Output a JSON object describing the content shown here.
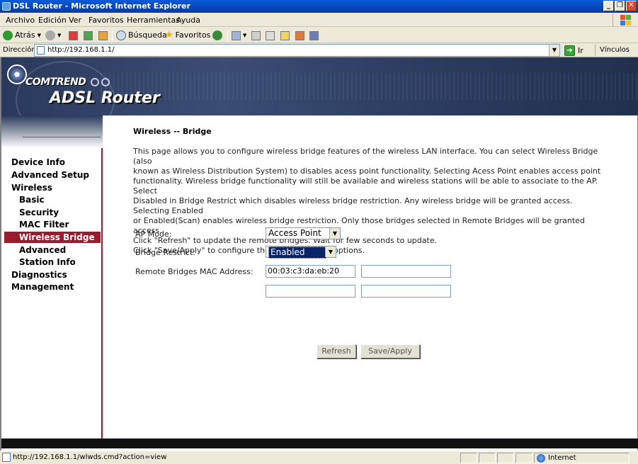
{
  "window": {
    "title": "DSL Router - Microsoft Internet Explorer",
    "controls": [
      "_",
      "❐",
      "✕"
    ]
  },
  "menu": [
    "Archivo",
    "Edición",
    "Ver",
    "Favoritos",
    "Herramientas",
    "Ayuda"
  ],
  "toolbar": {
    "back": "Atrás",
    "search": "Búsqueda",
    "favorites": "Favoritos"
  },
  "address": {
    "label": "Dirección",
    "url": "http://192.168.1.1/",
    "go": "Ir",
    "links": "Vínculos"
  },
  "banner": {
    "brand": "COMTREND",
    "product": "ADSL Router"
  },
  "sidebar": {
    "items": [
      {
        "label": "Device Info",
        "level": 0,
        "active": false
      },
      {
        "label": "Advanced Setup",
        "level": 0,
        "active": false
      },
      {
        "label": "Wireless",
        "level": 0,
        "active": false
      },
      {
        "label": "Basic",
        "level": 1,
        "active": false
      },
      {
        "label": "Security",
        "level": 1,
        "active": false
      },
      {
        "label": "MAC Filter",
        "level": 1,
        "active": false
      },
      {
        "label": "Wireless Bridge",
        "level": 1,
        "active": true
      },
      {
        "label": "Advanced",
        "level": 1,
        "active": false
      },
      {
        "label": "Station Info",
        "level": 1,
        "active": false
      },
      {
        "label": "Diagnostics",
        "level": 0,
        "active": false
      },
      {
        "label": "Management",
        "level": 0,
        "active": false
      }
    ]
  },
  "page": {
    "title": "Wireless -- Bridge",
    "description": [
      "This page allows you to configure wireless bridge features of the wireless LAN interface. You can select Wireless Bridge (also",
      "known as Wireless Distribution System) to disables acess point functionality. Selecting Acess Point enables access point",
      "functionality. Wireless bridge functionality will still be available and wireless stations will be able to associate to the AP. Select",
      "Disabled in Bridge Restrict which disables wireless bridge restriction. Any wireless bridge will be granted access. Selecting Enabled",
      "or Enabled(Scan) enables wireless bridge restriction. Only those bridges selected in Remote Bridges will be granted access.",
      "Click \"Refresh\" to update the remote bridges. Wait for few seconds to update.",
      "Click \"Save/Apply\" to configure the wireless bridge options."
    ],
    "ap_mode": {
      "label": "AP Mode:",
      "value": "Access Point"
    },
    "bridge_restrict": {
      "label": "Bridge Restrict:",
      "value": "Enabled"
    },
    "remote_bridges": {
      "label": "Remote Bridges MAC Address:",
      "values": [
        "00:03:c3:da:eb:20",
        "",
        "",
        ""
      ]
    },
    "buttons": {
      "refresh": "Refresh",
      "save": "Save/Apply"
    }
  },
  "status": {
    "text": "http://192.168.1.1/wlwds.cmd?action=view",
    "zone": "Internet"
  }
}
